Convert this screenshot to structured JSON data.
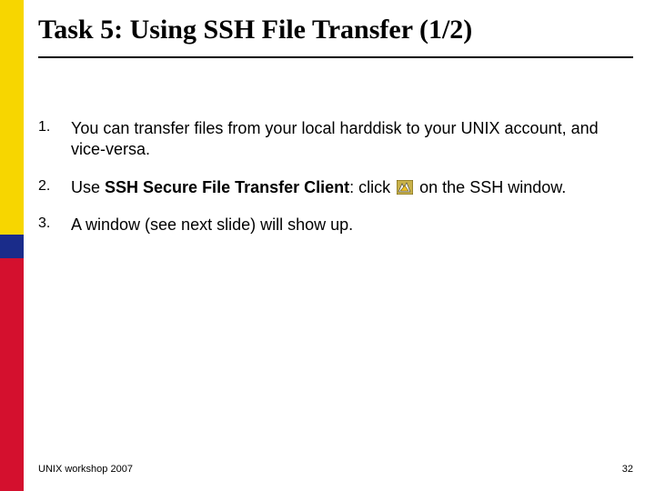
{
  "title": "Task 5: Using SSH File Transfer (1/2)",
  "items": [
    {
      "num": "1.",
      "text_plain": "You can transfer files from your local harddisk to your UNIX account, and vice-versa."
    },
    {
      "num": "2.",
      "text_before": "Use ",
      "text_bold": "SSH Secure File Transfer Client",
      "text_mid": ": click ",
      "text_after": " on the SSH window."
    },
    {
      "num": "3.",
      "text_plain": "A window (see next slide) will show up."
    }
  ],
  "icon_name": "ssh-file-transfer-icon",
  "footer": {
    "left": "UNIX workshop 2007",
    "page": "32"
  },
  "colors": {
    "yellow": "#f7d600",
    "blue": "#1a2c8a",
    "red": "#d4102e"
  }
}
